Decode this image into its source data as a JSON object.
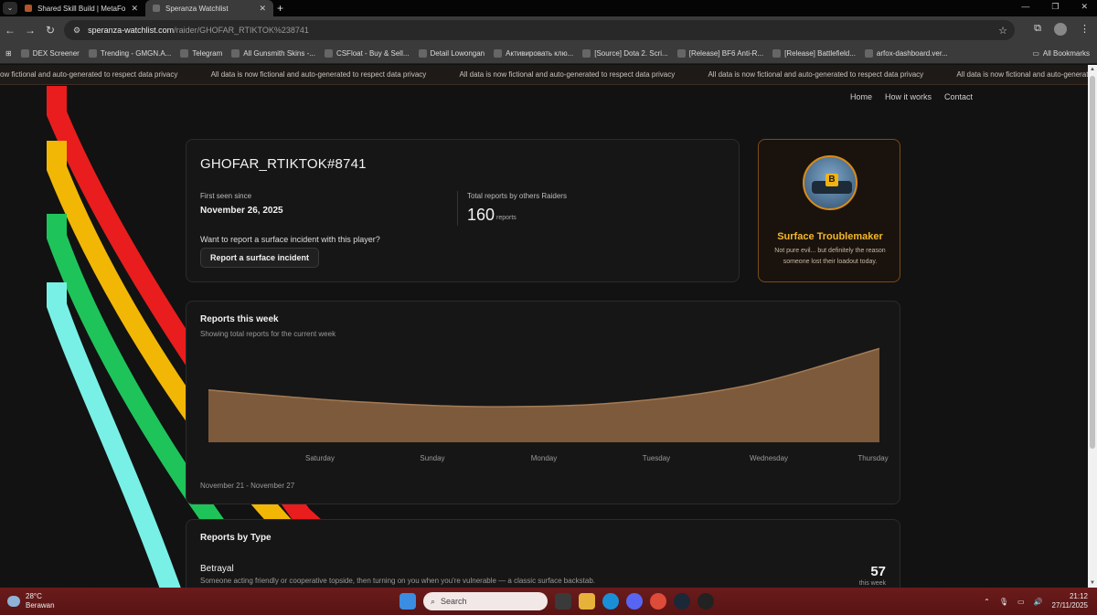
{
  "browser": {
    "tabs": [
      {
        "title": "Shared Skill Build | MetaForge",
        "active": false
      },
      {
        "title": "Speranza Watchlist",
        "active": true
      }
    ],
    "url_host": "speranza-watchlist.com",
    "url_path": "/raider/GHOFAR_RTIKTOK%238741",
    "bookmarks": [
      "DEX Screener",
      "Trending - GMGN.A...",
      "Telegram",
      "All Gunsmith Skins -...",
      "CSFloat - Buy & Sell...",
      "Detail Lowongan",
      "Активировать клю...",
      "[Source] Dota 2. Scri...",
      "[Release] BF6 Anti-R...",
      "[Release] Battlefield...",
      "arfox-dashboard.ver..."
    ],
    "all_bookmarks": "All Bookmarks"
  },
  "banner": {
    "first": "ow fictional and auto-generated to respect data privacy",
    "message": "All data is now fictional and auto-generated to respect data privacy"
  },
  "nav": {
    "home": "Home",
    "how": "How it works",
    "contact": "Contact"
  },
  "player": {
    "name": "GHOFAR_RTIKTOK#8741",
    "first_seen_label": "First seen since",
    "first_seen": "November 26, 2025",
    "total_label": "Total reports by others Raiders",
    "total": "160",
    "total_unit": "reports",
    "cta_question": "Want to report a surface incident with this player?",
    "cta_button": "Report a surface incident"
  },
  "badge": {
    "letter": "B",
    "title": "Surface Troublemaker",
    "desc": "Not pure evil... but definitely the reason someone lost their loadout today."
  },
  "week": {
    "title": "Reports this week",
    "subtitle": "Showing total reports for the current week",
    "range": "November 21 - November 27"
  },
  "chart_data": {
    "type": "area",
    "categories": [
      "Saturday",
      "Sunday",
      "Monday",
      "Tuesday",
      "Wednesday",
      "Thursday"
    ],
    "values": [
      6.3,
      5.0,
      4.3,
      4.7,
      6.8,
      11.3
    ],
    "ylim": [
      0,
      12
    ],
    "grid": false,
    "fill_color": "#7c5a3b",
    "line_color": "#a47b55"
  },
  "types": {
    "title": "Reports by Type",
    "items": [
      {
        "name": "Betrayal",
        "desc": "Someone acting friendly or cooperative topside, then turning on you when you're vulnerable — a classic surface backstab.",
        "count": "57",
        "unit": "this week"
      }
    ]
  },
  "taskbar": {
    "temp": "28°C",
    "weather": "Berawan",
    "search": "Search",
    "time": "21:12",
    "date": "27/11/2025"
  },
  "colors": {
    "stripes": [
      "#e91d1d",
      "#f2b705",
      "#1ec45a",
      "#79f0e6"
    ],
    "accent": "#f3b72d"
  }
}
